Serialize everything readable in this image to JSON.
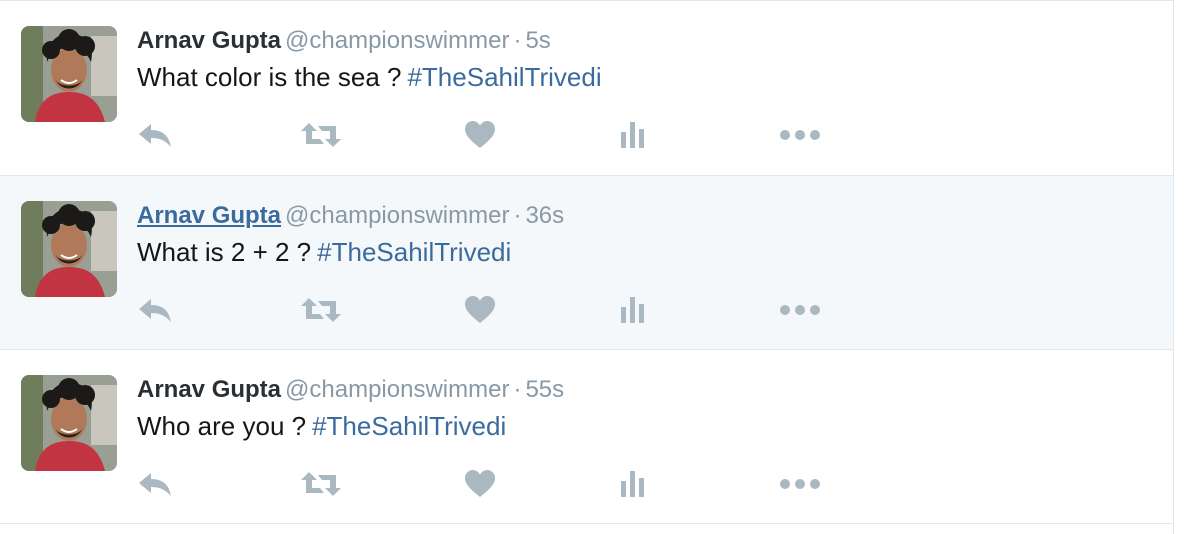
{
  "tweets": [
    {
      "fullname": "Arnav Gupta",
      "username": "@championswimmer",
      "separator": "·",
      "time": "5s",
      "text": "What color is the sea ?",
      "hashtag": "#TheSahilTrivedi",
      "hovered": false
    },
    {
      "fullname": "Arnav Gupta",
      "username": "@championswimmer",
      "separator": "·",
      "time": "36s",
      "text": "What is 2 + 2 ?",
      "hashtag": "#TheSahilTrivedi",
      "hovered": true
    },
    {
      "fullname": "Arnav Gupta",
      "username": "@championswimmer",
      "separator": "·",
      "time": "55s",
      "text": "Who are you ?",
      "hashtag": "#TheSahilTrivedi",
      "hovered": false
    }
  ],
  "actions": [
    "reply-icon",
    "retweet-icon",
    "like-icon",
    "analytics-icon",
    "more-icon"
  ],
  "colors": {
    "action_icon": "#aab8c2",
    "link": "#3b6b9e",
    "hover_bg": "#f5f8fa",
    "muted": "#8899a6"
  }
}
